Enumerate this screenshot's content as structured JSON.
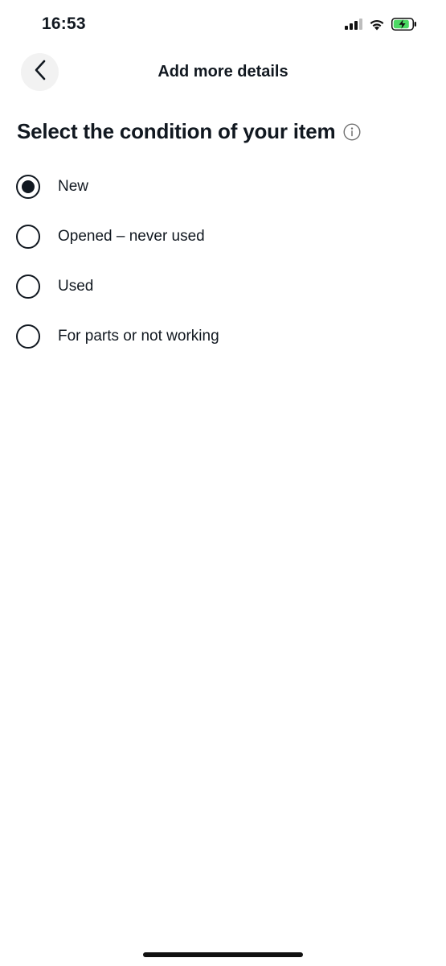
{
  "status_bar": {
    "time": "16:53",
    "icons": [
      "cellular-signal-icon",
      "wifi-icon",
      "battery-charging-icon"
    ],
    "battery_fill_color": "#4cd964"
  },
  "header": {
    "back_icon": "chevron-left-icon",
    "title": "Add more details"
  },
  "condition": {
    "heading": "Select the condition of your item",
    "info_icon": "info-icon",
    "options": [
      {
        "label": "New",
        "selected": true
      },
      {
        "label": "Opened – never used",
        "selected": false
      },
      {
        "label": "Used",
        "selected": false
      },
      {
        "label": "For parts or not working",
        "selected": false
      }
    ]
  },
  "colors": {
    "text": "#111820",
    "back_button_bg": "#f2f2f2",
    "info_icon": "#707070"
  }
}
